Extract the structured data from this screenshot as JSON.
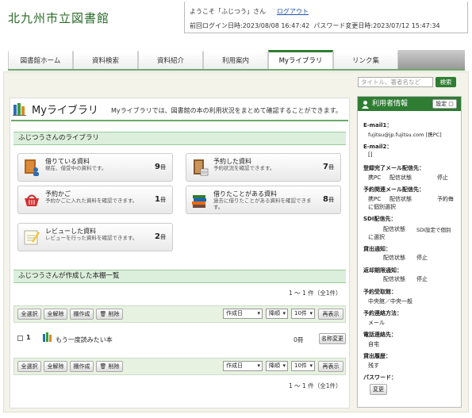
{
  "site_title": "北九州市立図書館",
  "header": {
    "welcome": "ようこそ「ふじつう」さん",
    "logout": "ログアウト",
    "last_login": "前回ログイン日時:2023/08/08 16:47:42",
    "pw_change": "パスワード変更日時:2023/07/12 15:47:34"
  },
  "tabs": [
    "図書館ホーム",
    "資料検索",
    "資料紹介",
    "利用案内",
    "Myライブラリ",
    "リンク集"
  ],
  "search": {
    "placeholder": "タイトル、著者名など",
    "button": "検索"
  },
  "mylib": {
    "title": "Myライブラリ",
    "desc": "Myライブラリでは、図書館の本の利用状況をまとめて確認することができます。",
    "section": "ふじつうさんのライブラリ"
  },
  "cards": [
    {
      "title": "借りている資料",
      "desc": "現在、借受中の資料です。",
      "count": "9",
      "unit": "冊",
      "icon": "borrowed-books-icon"
    },
    {
      "title": "予約した資料",
      "desc": "予約状況を確認できます。",
      "count": "7",
      "unit": "冊",
      "icon": "reserved-book-icon"
    },
    {
      "title": "予約かご",
      "desc": "予約かごに入れた資料を確認できます。",
      "count": "1",
      "unit": "冊",
      "icon": "basket-icon"
    },
    {
      "title": "借りたことがある資料",
      "desc": "過去に借りたことがある資料を確認できます。",
      "count": "8",
      "unit": "冊",
      "icon": "history-books-icon"
    },
    {
      "title": "レビューした資料",
      "desc": "レビューを行った資料を確認できます。",
      "count": "2",
      "unit": "冊",
      "icon": "review-icon"
    }
  ],
  "shelf": {
    "section": "ふじつうさんが作成した本棚一覧",
    "pager": "1 ～ 1 件（全1件）",
    "buttons": [
      "全選択",
      "全解除",
      "棚作成",
      "削除"
    ],
    "sort": "作成日",
    "order": "降順",
    "per": "10件",
    "redisplay": "再表示",
    "row": {
      "num": "1",
      "name": "もう一度読みたい本",
      "count": "0冊",
      "rename": "名称変更"
    }
  },
  "user": {
    "title": "利用者情報",
    "setting": "設定",
    "email1_label": "E-mail1：",
    "email1": "fujitsu@jp.fujitsu.com [携PC]",
    "email2_label": "E-mail2：",
    "email2": "[]",
    "reg_label": "登録完了メール配信先：",
    "reg_a": "携PC",
    "reg_b": "配信状態",
    "reg_c": "停止",
    "rsv_label": "予約関連メール配信先：",
    "rsv_a": "携PC",
    "rsv_b": "配信状態",
    "rsv_c": "予約毎",
    "rsv_d": "に個別選択",
    "sdi_label": "SDI配信先：",
    "sdi_b": "配信状態",
    "sdi_c": "SDI設定で個別",
    "sdi_d": "に選択",
    "lend_label": "貸出通知：",
    "lend_b": "配信状態",
    "lend_c": "停止",
    "over_label": "返却期限通知：",
    "over_b": "配信状態",
    "over_c": "停止",
    "pick_label": "予約受取館：",
    "pick": "中央館／中央一般",
    "contact_label": "予約連絡方法：",
    "contact": "メール",
    "tel_label": "電話連絡先：",
    "tel": "自宅",
    "hist_label": "貸出履歴：",
    "hist": "残す",
    "pw_label": "パスワード：",
    "pw_btn": "変更"
  },
  "colors": {
    "green": "#2e7d32",
    "bar": "#dceedc"
  }
}
